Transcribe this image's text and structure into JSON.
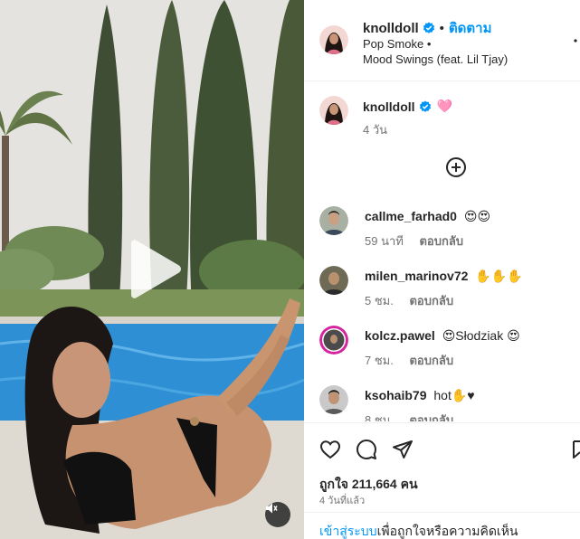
{
  "post": {
    "author": "knolldoll",
    "follow_label": "ติดตาม",
    "separator": "•",
    "music_artist": "Pop Smoke •",
    "music_title": "Mood Swings (feat. Lil Tjay)",
    "caption_emoji": "🩷",
    "caption_time": "4 วัน"
  },
  "comments": [
    {
      "user": "callme_farhad0",
      "text": "😍😍",
      "time": "59 นาที",
      "reply": "ตอบกลับ"
    },
    {
      "user": "milen_marinov72",
      "text": "✋✋✋",
      "time": "5 ชม.",
      "reply": "ตอบกลับ"
    },
    {
      "user": "kolcz.pawel",
      "text": "😍Słodziak 😍",
      "time": "7 ชม.",
      "reply": "ตอบกลับ"
    },
    {
      "user": "ksohaib79",
      "text": "hot✋♥",
      "time": "8 ชม.",
      "reply": "ตอบกลับ"
    }
  ],
  "stats": {
    "likes": "ถูกใจ 211,664 คน",
    "posted": "4 วันที่แล้ว"
  },
  "login": {
    "link": "เข้าสู่ระบบ",
    "rest": "เพื่อถูกใจหรือความคิดเห็น"
  },
  "icons": {
    "verified": "verified-badge-icon",
    "play": "play-icon",
    "mute": "muted-speaker-icon",
    "more": "more-options-icon",
    "add": "add-circle-icon",
    "like": "heart-icon",
    "comment": "comment-bubble-icon",
    "share": "paper-plane-icon",
    "save": "bookmark-icon"
  },
  "colors": {
    "accent": "#0095f6",
    "verified": "#0095f6",
    "text": "#262626",
    "muted": "#737373"
  }
}
